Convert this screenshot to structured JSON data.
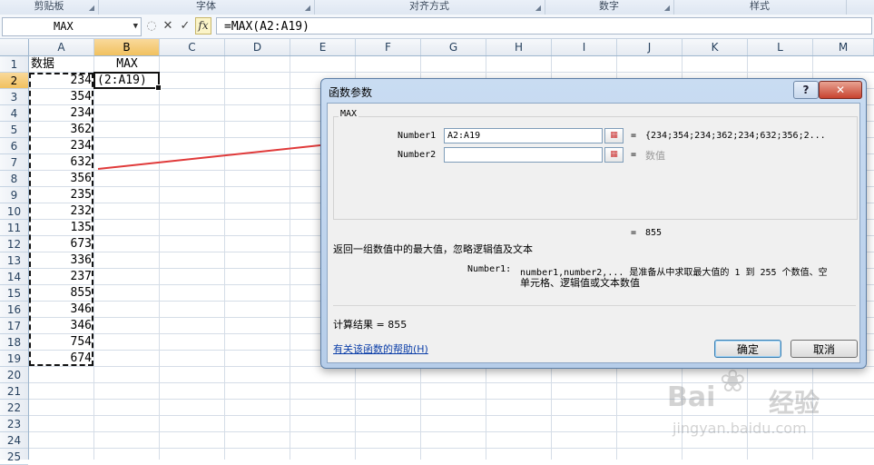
{
  "ribbon": {
    "groups": [
      {
        "label": "剪贴板"
      },
      {
        "label": "字体"
      },
      {
        "label": "对齐方式"
      },
      {
        "label": "数字"
      },
      {
        "label": "样式"
      }
    ]
  },
  "formula_bar": {
    "name_box": "MAX",
    "cancel_glyph": "✕",
    "enter_glyph": "✓",
    "fx_label": "fx",
    "formula": "=MAX(A2:A19)"
  },
  "columns": [
    "A",
    "B",
    "C",
    "D",
    "E",
    "F",
    "G",
    "H",
    "I",
    "J",
    "K",
    "L",
    "M"
  ],
  "rows": [
    "1",
    "2",
    "3",
    "4",
    "5",
    "6",
    "7",
    "8",
    "9",
    "10",
    "11",
    "12",
    "13",
    "14",
    "15",
    "16",
    "17",
    "18",
    "19",
    "20",
    "21",
    "22",
    "23",
    "24",
    "25"
  ],
  "cells": {
    "A1": "数据",
    "B1": "MAX",
    "B2": "(2:A19)",
    "A_values": [
      "234",
      "354",
      "234",
      "362",
      "234",
      "632",
      "356",
      "235",
      "232",
      "135",
      "673",
      "336",
      "237",
      "855",
      "346",
      "346",
      "754",
      "674"
    ]
  },
  "dialog": {
    "title": "函数参数",
    "help_glyph": "?",
    "close_glyph": "✕",
    "function_name": "MAX",
    "args": [
      {
        "label": "Number1",
        "value": "A2:A19",
        "eq": "=",
        "result": "{234;354;234;362;234;632;356;2..."
      },
      {
        "label": "Number2",
        "value": "",
        "eq": "=",
        "result": "数值"
      }
    ],
    "total_eq": "=",
    "total_value": "855",
    "description": "返回一组数值中的最大值，忽略逻辑值及文本",
    "arg_help_label": "Number1:",
    "arg_help_line1": "number1,number2,... 是准备从中求取最大值的 1 到 255 个数值、空",
    "arg_help_line2": "单元格、逻辑值或文本数值",
    "calc_result": "计算结果 = 855",
    "help_link": "有关该函数的帮助(H)",
    "ok_label": "确定",
    "cancel_label": "取消"
  },
  "watermark": {
    "brand": "Bai",
    "brand2": "经验",
    "url": "jingyan.baidu.com"
  },
  "colors": {
    "arrow": "#e03a3a",
    "active_header": "#f1c15f",
    "link": "#0b3ea8"
  }
}
